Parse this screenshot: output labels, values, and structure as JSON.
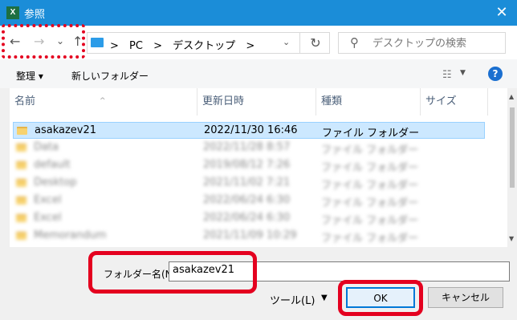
{
  "window": {
    "title": "参照",
    "app_icon": "excel-icon",
    "close_glyph": "✕"
  },
  "nav": {
    "back": "←",
    "forward": "→",
    "recent": "⌄",
    "up": "↑",
    "breadcrumbs": [
      "PC",
      ">",
      "デスクトップ",
      ">"
    ],
    "breadcrumb_lead": ">",
    "refresh": "↻",
    "search_placeholder": "デスクトップの検索"
  },
  "toolbar": {
    "organize": "整理 ▾",
    "new_folder": "新しいフォルダー",
    "help": "?"
  },
  "columns": [
    "名前",
    "更新日時",
    "種類",
    "サイズ"
  ],
  "files": [
    {
      "name": "asakazev21",
      "date": "2022/11/30 16:46",
      "type": "ファイル フォルダー",
      "selected": true
    },
    {
      "name": "Data",
      "date": "2022/11/28 8:57",
      "type": "ファイル フォルダー",
      "blurred": true
    },
    {
      "name": "default",
      "date": "2019/08/12 7:26",
      "type": "ファイル フォルダー",
      "blurred": true
    },
    {
      "name": "Desktop",
      "date": "2021/11/02 7:21",
      "type": "ファイル フォルダー",
      "blurred": true
    },
    {
      "name": "Excel",
      "date": "2022/06/24 6:30",
      "type": "ファイル フォルダー",
      "blurred": true
    },
    {
      "name": "Excel",
      "date": "2022/06/24 6:30",
      "type": "ファイル フォルダー",
      "blurred": true
    },
    {
      "name": "Memorandum",
      "date": "2021/11/09 10:29",
      "type": "ファイル フォルダー",
      "blurred": true
    }
  ],
  "footer": {
    "folder_label": "フォルダー名(N):",
    "folder_value": "asakazev21",
    "tools": "ツール(L)",
    "tools_dd": "▼",
    "ok": "OK",
    "cancel": "キャンセル"
  },
  "colors": {
    "title_bar": "#1b8dd8",
    "highlight": "#e4001f",
    "selection": "#cce8ff"
  }
}
